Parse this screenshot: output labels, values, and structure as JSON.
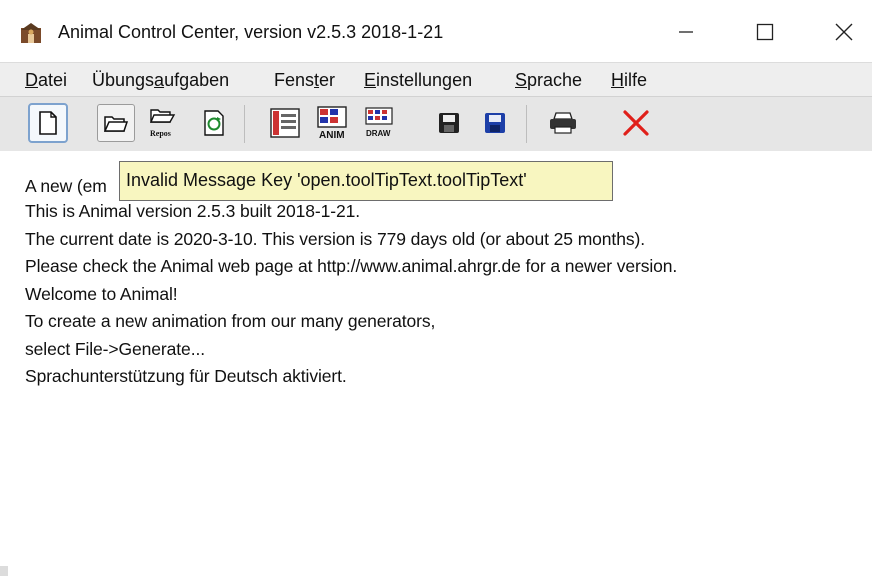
{
  "window": {
    "title": "Animal Control Center, version v2.5.3 2018-1-21",
    "icon": "animal-app-icon",
    "controls": [
      "minimize-icon",
      "maximize-icon",
      "close-icon"
    ]
  },
  "menu": {
    "items": [
      {
        "label": "Datei",
        "mnemonic": "D"
      },
      {
        "label": "Übungsaufgaben",
        "mnemonic": "a"
      },
      {
        "label": "Fenster",
        "mnemonic": "t"
      },
      {
        "label": "Einstellungen",
        "mnemonic": "E"
      },
      {
        "label": "Sprache",
        "mnemonic": "S"
      },
      {
        "label": "Hilfe",
        "mnemonic": "H"
      }
    ]
  },
  "toolbar": {
    "buttons": [
      {
        "icon": "new-document-icon"
      },
      {
        "icon": "open-folder-icon"
      },
      {
        "icon": "repository-icon",
        "label": "Repos"
      },
      {
        "icon": "refresh-icon"
      },
      {
        "icon": "animation-editor-icon"
      },
      {
        "icon": "anim-format-icon",
        "label": "ANIM"
      },
      {
        "icon": "draw-icon",
        "label": "DRAW"
      },
      {
        "icon": "save-icon"
      },
      {
        "icon": "save-as-icon"
      },
      {
        "icon": "print-icon"
      },
      {
        "icon": "close-red-x-icon"
      }
    ]
  },
  "log": {
    "lines": [
      "A new (em",
      "This is Animal version 2.5.3 built 2018-1-21.",
      "The current date is 2020-3-10. This version is 779 days old (or about 25 months).",
      "Please check the Animal web page at http://www.animal.ahrgr.de for a newer version.",
      "Welcome to Animal!",
      "To create a new animation from our many generators,",
      "select File->Generate...",
      "Sprachunterstützung für Deutsch aktiviert."
    ]
  },
  "tooltip": {
    "text": "Invalid Message Key 'open.toolTipText.toolTipText'"
  },
  "colors": {
    "tooltip_bg": "#f8f6c0",
    "menubar_bg": "#eeeeee",
    "toolbar_bg": "#e6e6e6",
    "close_x": "#e0201a",
    "save_blue": "#1d3fa8"
  }
}
